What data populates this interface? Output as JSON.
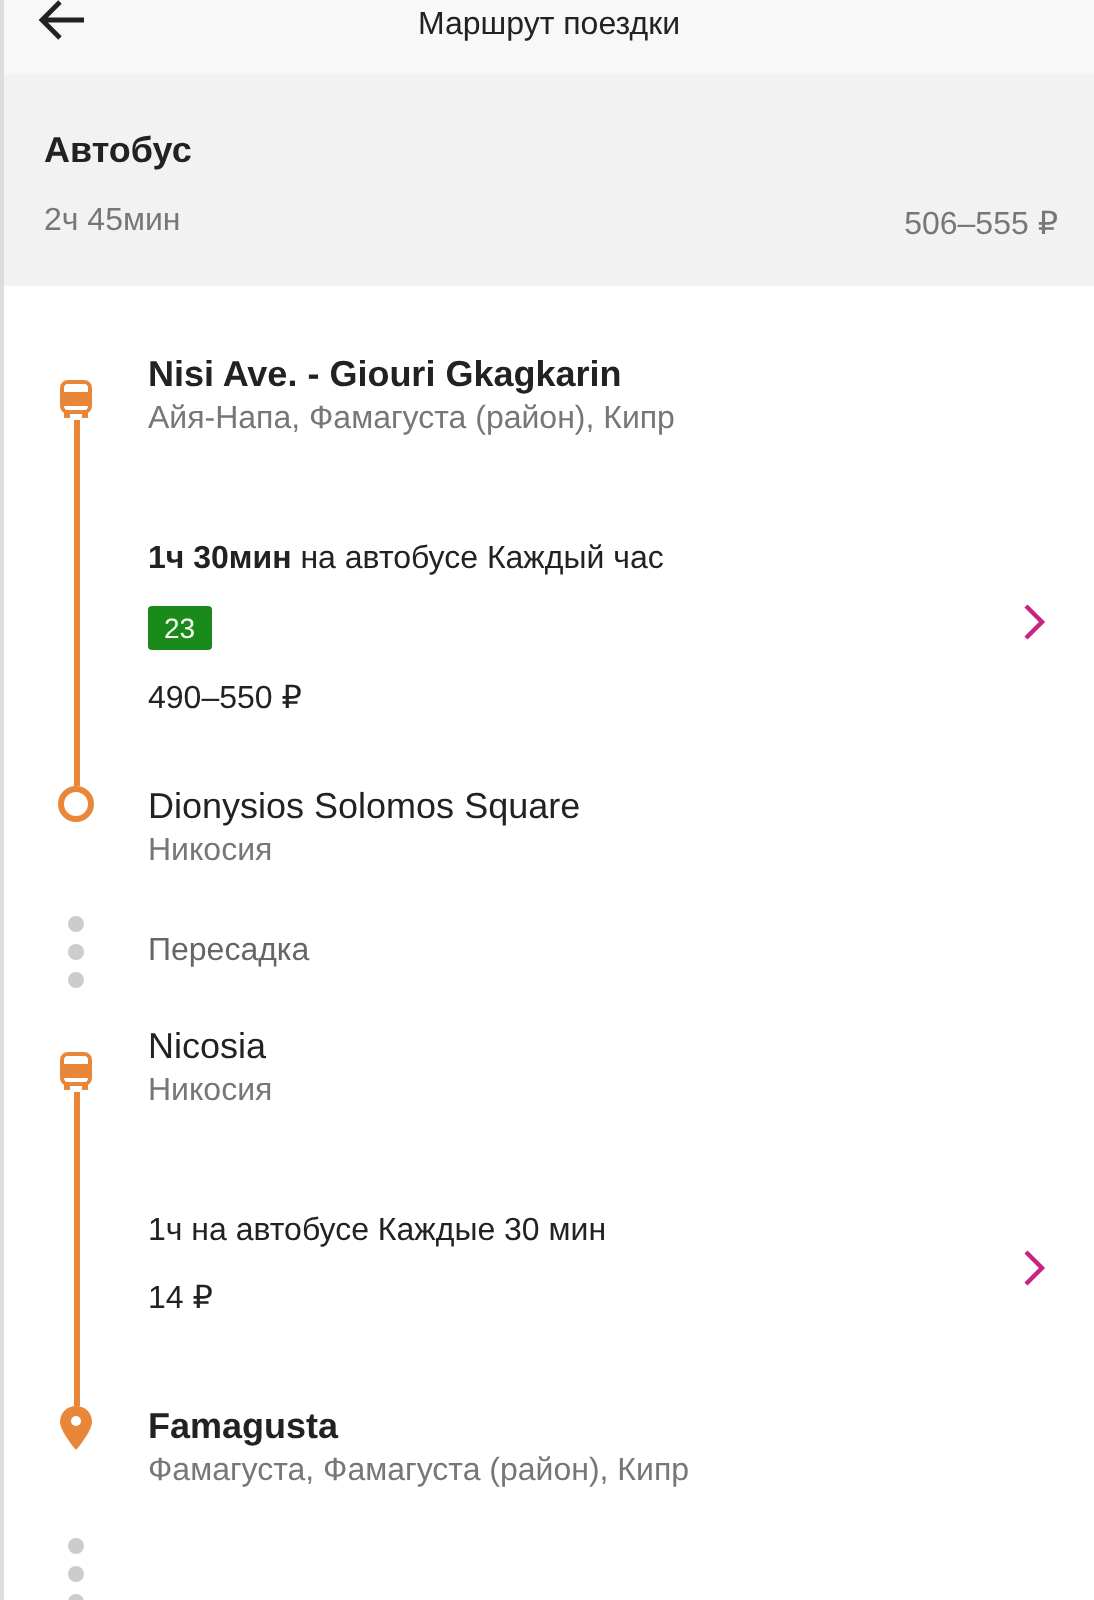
{
  "header": {
    "title": "Маршрут поездки"
  },
  "summary": {
    "mode": "Автобус",
    "duration": "2ч 45мин",
    "price": "506–555 ₽"
  },
  "timeline": [
    {
      "kind": "departure",
      "name": "Nisi Ave. - Giouri Gkagkarin",
      "place": "Айя-Напа, Фамагуста (район), Кипр",
      "emphasis": true
    },
    {
      "kind": "leg",
      "description": "**1ч 30мин** на автобусе Каждый час",
      "route": "23",
      "price": "490–550 ₽",
      "color": "#1a8a1a"
    },
    {
      "kind": "arrival",
      "name": "Dionysios Solomos Square",
      "place": "Никосия",
      "emphasis": false
    },
    {
      "kind": "transfer",
      "label": "Пересадка"
    },
    {
      "kind": "departure",
      "name": "Nicosia",
      "place": "Никосия",
      "emphasis": false
    },
    {
      "kind": "leg",
      "description": "1ч на автобусе Каждые 30 мин",
      "price": "14 ₽"
    },
    {
      "kind": "destination",
      "name": "Famagusta",
      "place": "Фамагуста, Фамагуста (район), Кипр",
      "emphasis": true
    },
    {
      "kind": "dots"
    }
  ]
}
